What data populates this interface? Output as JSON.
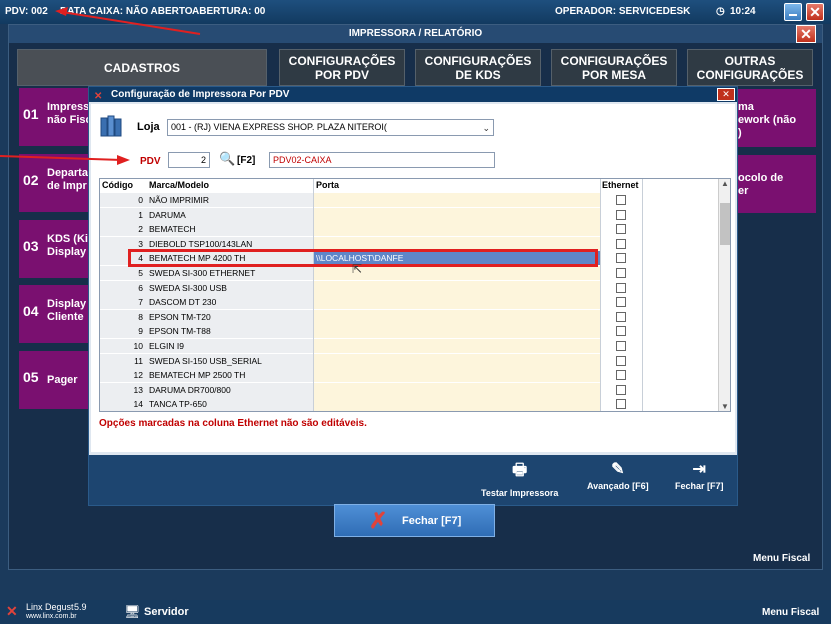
{
  "topbar": {
    "pdv": "PDV: 002",
    "data_caixa": "DATA CAIXA: NÃO ABERTO",
    "abertura": "ABERTURA: 00",
    "operador": "OPERADOR: SERVICEDESK",
    "time": "10:24",
    "clock_icon": "clock-icon"
  },
  "app": {
    "header": "IMPRESSORA / RELATÓRIO",
    "tabs": [
      {
        "label": "CADASTROS"
      },
      {
        "label": "CONFIGURAÇÕES\nPOR PDV"
      },
      {
        "label": "CONFIGURAÇÕES\nDE KDS"
      },
      {
        "label": "CONFIGURAÇÕES\nPOR MESA"
      },
      {
        "label": "OUTRAS\nCONFIGURAÇÕES"
      }
    ],
    "left_menu": [
      {
        "num": "01",
        "label": "Impress\nnão Fisc"
      },
      {
        "num": "02",
        "label": "Departa\nde Impr"
      },
      {
        "num": "03",
        "label": "KDS (Kit\nDisplay"
      },
      {
        "num": "04",
        "label": "Display\nCliente"
      },
      {
        "num": "05",
        "label": "Pager"
      }
    ],
    "right_menu": [
      {
        "label": "ma\nework (não\n)"
      },
      {
        "label": "ocolo de\ner"
      }
    ],
    "close_button": "Fechar [F7]",
    "menu_fiscal_inner": "Menu Fiscal"
  },
  "dialog": {
    "title": "Configuração de Impressora Por PDV",
    "loja_label": "Loja",
    "loja_value": "001 - (RJ) VIENA EXPRESS  SHOP. PLAZA NITEROI(",
    "pdv_label": "PDV",
    "pdv_value": "2",
    "f2_label": "[F2]",
    "pdv_name": "PDV02-CAIXA",
    "columns": {
      "codigo": "Código",
      "marca": "Marca/Modelo",
      "porta": "Porta",
      "ethernet": "Ethernet"
    },
    "rows": [
      {
        "code": "0",
        "model": "NÃO IMPRIMIR",
        "port": ""
      },
      {
        "code": "1",
        "model": "DARUMA",
        "port": ""
      },
      {
        "code": "2",
        "model": "BEMATECH",
        "port": ""
      },
      {
        "code": "3",
        "model": "DIEBOLD TSP100/143LAN",
        "port": ""
      },
      {
        "code": "4",
        "model": "BEMATECH MP 4200 TH",
        "port": "\\\\LOCALHOST\\DANFE"
      },
      {
        "code": "5",
        "model": "SWEDA SI-300 ETHERNET",
        "port": ""
      },
      {
        "code": "6",
        "model": "SWEDA SI-300 USB",
        "port": ""
      },
      {
        "code": "7",
        "model": "DASCOM DT 230",
        "port": ""
      },
      {
        "code": "8",
        "model": "EPSON TM-T20",
        "port": ""
      },
      {
        "code": "9",
        "model": "EPSON TM-T88",
        "port": ""
      },
      {
        "code": "10",
        "model": "ELGIN I9",
        "port": ""
      },
      {
        "code": "11",
        "model": "SWEDA SI-150 USB_SERIAL",
        "port": ""
      },
      {
        "code": "12",
        "model": "BEMATECH MP 2500 TH",
        "port": ""
      },
      {
        "code": "13",
        "model": "DARUMA DR700/800",
        "port": ""
      },
      {
        "code": "14",
        "model": "TANCA TP-650",
        "port": ""
      }
    ],
    "note": "Opções marcadas na coluna Ethernet não são editáveis.",
    "buttons": {
      "testar": "Testar Impressora",
      "avancado": "Avançado [F6]",
      "fechar": "Fechar [F7]"
    }
  },
  "statusbar": {
    "brand": "Linx Degust",
    "version": "5.9",
    "site": "www.linx.com.br",
    "servidor": "Servidor",
    "menu_fiscal": "Menu Fiscal"
  }
}
